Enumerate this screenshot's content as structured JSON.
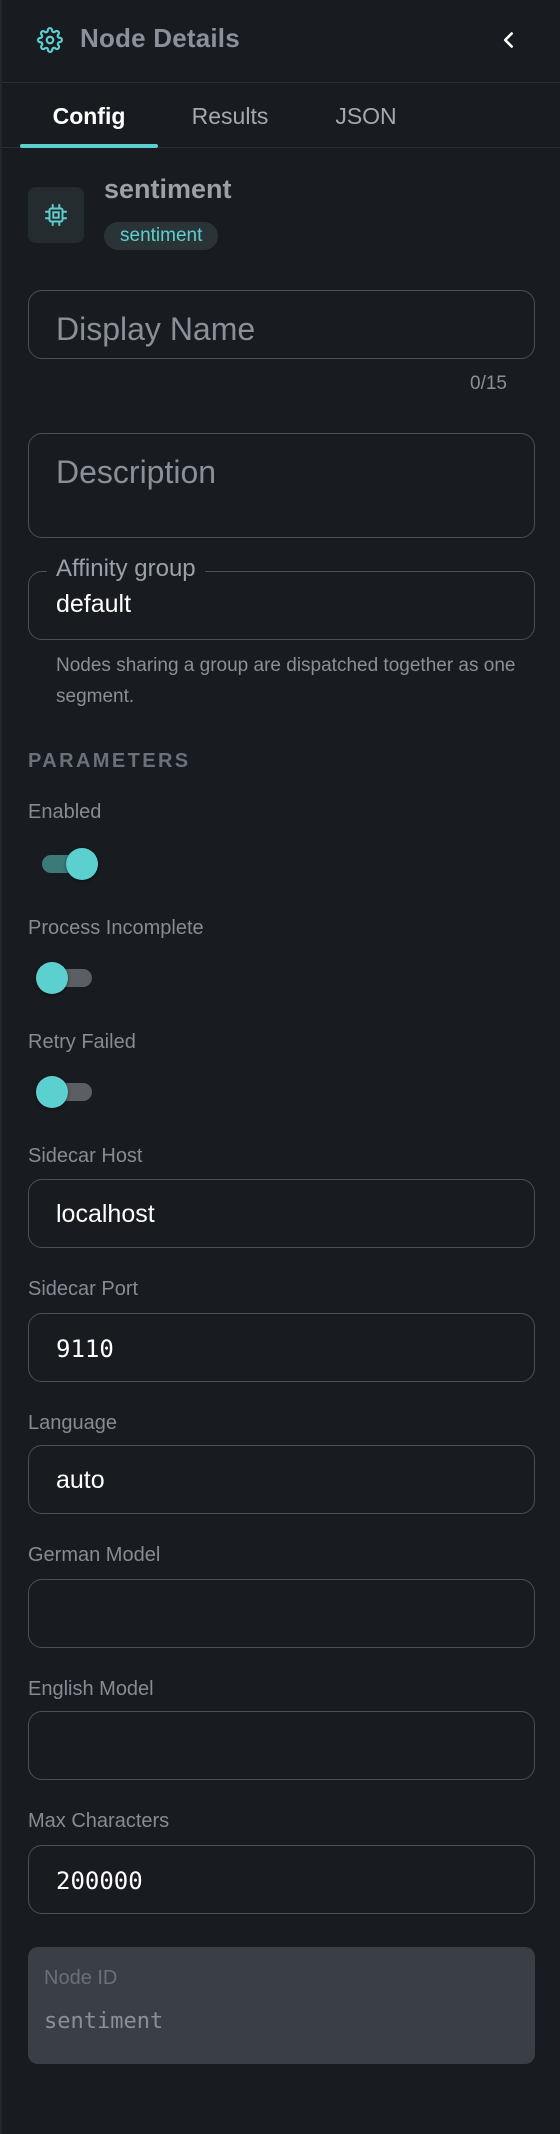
{
  "header": {
    "title": "Node Details",
    "icon": "gear-icon",
    "collapse_icon": "chevron-left-icon"
  },
  "tabs": [
    {
      "label": "Config",
      "active": true
    },
    {
      "label": "Results",
      "active": false
    },
    {
      "label": "JSON",
      "active": false
    }
  ],
  "node": {
    "name": "sentiment",
    "type_chip": "sentiment",
    "icon": "chip-icon"
  },
  "display_name": {
    "placeholder": "Display Name",
    "value": "",
    "counter": "0/15"
  },
  "description": {
    "placeholder": "Description",
    "value": ""
  },
  "affinity": {
    "label": "Affinity group",
    "value": "default",
    "helper": "Nodes sharing a group are dispatched together as one segment."
  },
  "parameters": {
    "section_title": "PARAMETERS",
    "enabled": {
      "label": "Enabled",
      "value": true
    },
    "process_incomplete": {
      "label": "Process Incomplete",
      "value": false
    },
    "retry_failed": {
      "label": "Retry Failed",
      "value": false
    },
    "sidecar_host": {
      "label": "Sidecar Host",
      "value": "localhost"
    },
    "sidecar_port": {
      "label": "Sidecar Port",
      "value": "9110"
    },
    "language": {
      "label": "Language",
      "value": "auto"
    },
    "german_model": {
      "label": "German Model",
      "value": ""
    },
    "english_model": {
      "label": "English Model",
      "value": ""
    },
    "max_characters": {
      "label": "Max Characters",
      "value": "200000"
    }
  },
  "node_id": {
    "label": "Node ID",
    "value": "sentiment"
  },
  "colors": {
    "accent": "#5ccfcf",
    "background": "#181b1f",
    "border": "#4b5056",
    "muted_text": "#868c93"
  }
}
